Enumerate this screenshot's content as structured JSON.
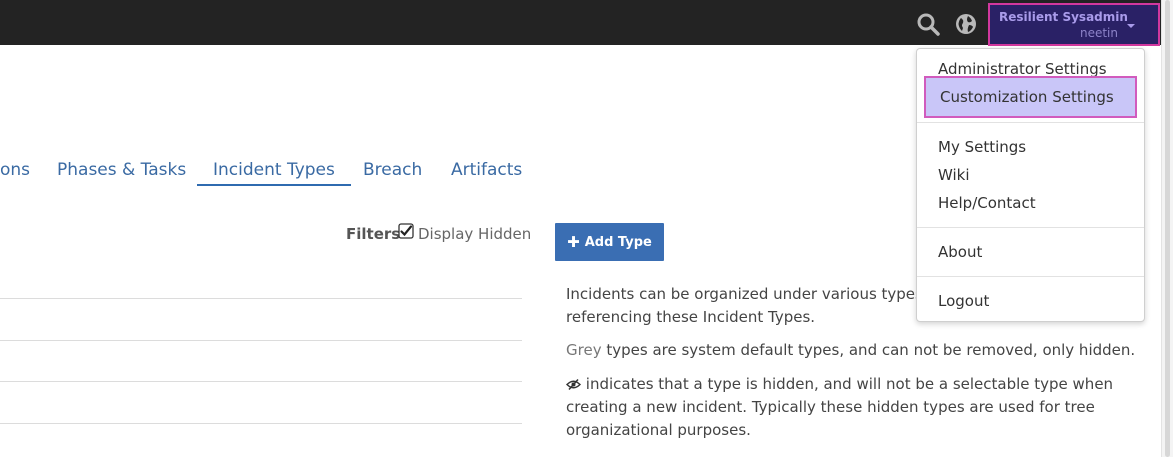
{
  "header": {
    "user_name": "Resilient Sysadmin",
    "user_login": "neetin"
  },
  "tabs": [
    {
      "label": "ons"
    },
    {
      "label": "Phases & Tasks"
    },
    {
      "label": "Incident Types"
    },
    {
      "label": "Breach"
    },
    {
      "label": "Artifacts"
    }
  ],
  "filters": {
    "label": "Filters",
    "display_hidden_label": "Display Hidden",
    "display_hidden_checked": true
  },
  "add_type_label": "Add Type",
  "info": {
    "p1_line1": "Incidents can be organized under various types. Yo",
    "p1_line2": "referencing these Incident Types.",
    "p2_grey": "Grey",
    "p2_rest": " types are system default types, and can not be removed, only hidden.",
    "p3_line1": " indicates that a type is hidden, and will not be a selectable type when",
    "p3_line2": "creating a new incident. Typically these hidden types are used for tree",
    "p3_line3": "organizational purposes."
  },
  "menu": {
    "items": [
      {
        "label": "Administrator Settings"
      },
      {
        "label": "Customization Settings"
      },
      {
        "label": "My Settings"
      },
      {
        "label": "Wiki"
      },
      {
        "label": "Help/Contact"
      },
      {
        "label": "About"
      },
      {
        "label": "Logout"
      }
    ]
  },
  "colors": {
    "topbar": "#232323",
    "user_button_bg": "#2a2166",
    "highlight_border": "#d2389e",
    "accent_blue": "#3a6eb3"
  }
}
